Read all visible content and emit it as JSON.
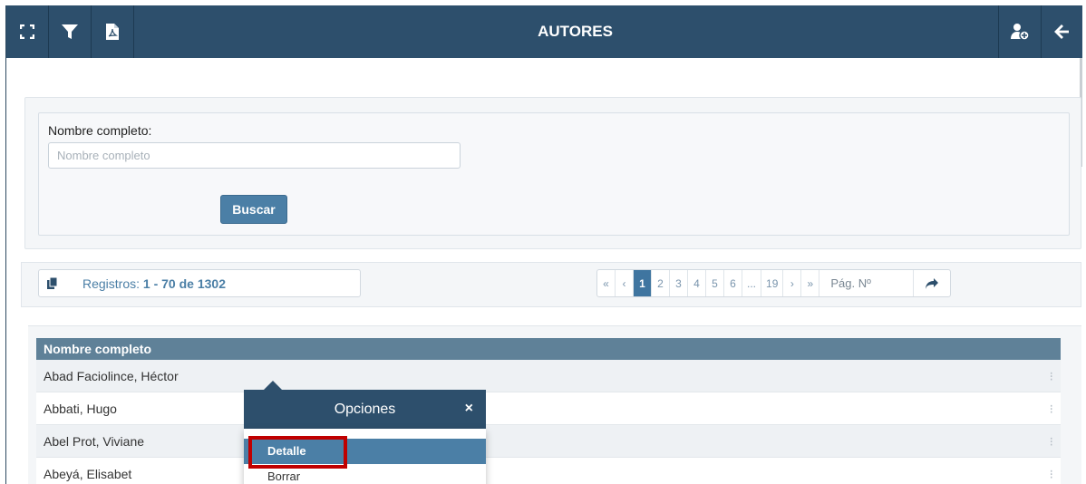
{
  "header": {
    "title": "AUTORES",
    "bg_color": "#2d4f6c"
  },
  "search": {
    "label": "Nombre completo:",
    "placeholder": "Nombre completo",
    "value": "",
    "button": "Buscar"
  },
  "records": {
    "prefix": "Registros: ",
    "range": "1 - 70 de 1302"
  },
  "pagination": {
    "first": "«",
    "prev": "‹",
    "pages": [
      "1",
      "2",
      "3",
      "4",
      "5",
      "6",
      "...",
      "19"
    ],
    "active": "1",
    "next": "›",
    "last": "»",
    "page_input_placeholder": "Pág. Nº"
  },
  "table": {
    "header": "Nombre completo",
    "rows": [
      "Abad Faciolince, Héctor",
      "Abbati, Hugo",
      "Abel Prot, Viviane",
      "Abeyá, Elisabet"
    ]
  },
  "popup": {
    "title": "Opciones",
    "close": "×",
    "options": [
      "Detalle",
      "Borrar"
    ],
    "selected": "Detalle",
    "highlight_color": "#c00000"
  }
}
